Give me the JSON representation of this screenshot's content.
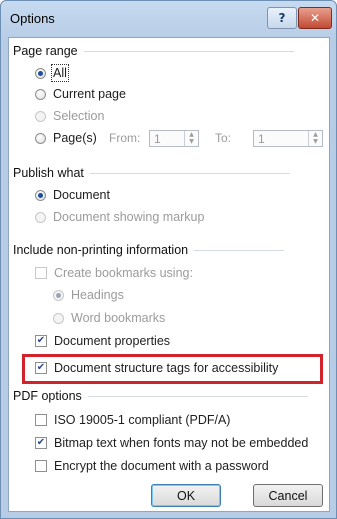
{
  "dialog": {
    "title": "Options"
  },
  "titlebar": {
    "help": "?",
    "close": "✕"
  },
  "page_range": {
    "heading": "Page range",
    "all": "All",
    "current_page": "Current page",
    "selection": "Selection",
    "pages": "Page(s)",
    "from_label": "From:",
    "from_value": "1",
    "to_label": "To:",
    "to_value": "1"
  },
  "publish_what": {
    "heading": "Publish what",
    "document": "Document",
    "document_markup": "Document showing markup"
  },
  "non_printing": {
    "heading": "Include non-printing information",
    "create_bookmarks": "Create bookmarks using:",
    "headings": "Headings",
    "word_bookmarks": "Word bookmarks",
    "document_properties": "Document properties",
    "structure_tags": "Document structure tags for accessibility"
  },
  "pdf_options": {
    "heading": "PDF options",
    "iso": "ISO 19005-1 compliant (PDF/A)",
    "bitmap_text": "Bitmap text when fonts may not be embedded",
    "encrypt": "Encrypt the document with a password"
  },
  "buttons": {
    "ok": "OK",
    "cancel": "Cancel"
  },
  "icons": {
    "check": "checkmark-icon",
    "spin_up": "up-arrow-icon",
    "spin_down": "down-arrow-icon"
  },
  "colors": {
    "highlight": "#d2232a",
    "title_bar": "#b7cde6",
    "radio_selected": "#1b4f9c"
  }
}
